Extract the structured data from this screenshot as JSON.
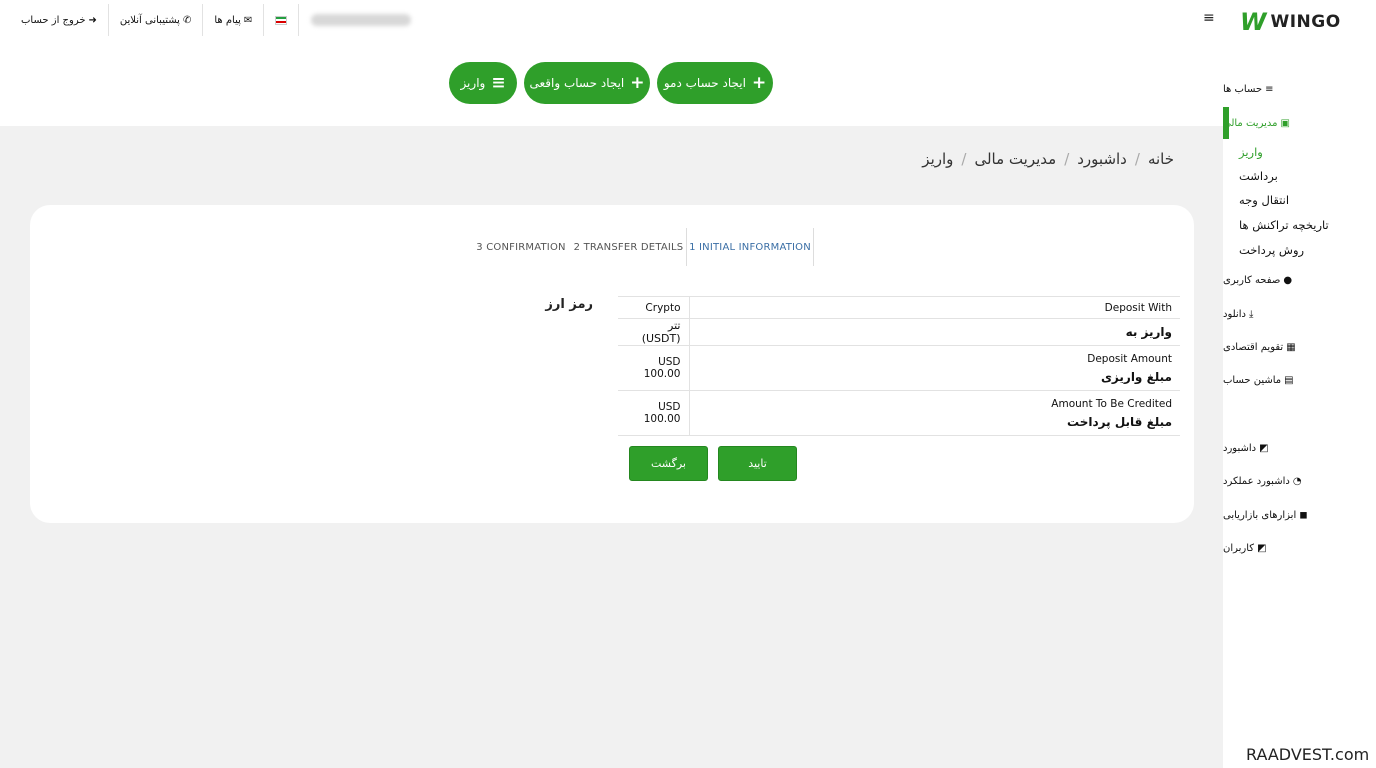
{
  "topbar": {
    "logout": "خروج از حساب",
    "support": "پشتیبانی آنلاین",
    "messages": "پیام ها",
    "flag_colors": [
      "#239f40",
      "#ffffff",
      "#da0000"
    ],
    "menu_icon": "hamburger-icon"
  },
  "actions": {
    "demo": "ایجاد حساب دمو",
    "real": "ایجاد حساب واقعی",
    "deposit": "واریز",
    "accent": "#2f9f2a"
  },
  "breadcrumb": [
    "خانه",
    "داشبورد",
    "مدیریت مالی",
    "واریز"
  ],
  "steps": [
    {
      "label": "3 CONFIRMATION"
    },
    {
      "label": "2 TRANSFER DETAILS"
    },
    {
      "label": "1 INITIAL INFORMATION"
    }
  ],
  "section_label": "رمز ارز",
  "rows": [
    {
      "key": "Deposit With",
      "value": "Crypto"
    },
    {
      "key": "واریز به",
      "value": "تتر (USDT)"
    },
    {
      "key": "Deposit Amount",
      "key_fa": "مبلغ واریزی",
      "value": "USD 100.00"
    },
    {
      "key": "Amount To Be Credited",
      "key_fa": "مبلغ قابل پرداخت",
      "value": "USD 100.00"
    }
  ],
  "buttons": {
    "back": "برگشت",
    "confirm": "تایید"
  },
  "sidebar": {
    "logo_mark": "W",
    "logo_text": "WINGO",
    "accounts": "حساب ها",
    "finance": "مدیریت مالی",
    "finance_sub": [
      "واریز",
      "برداشت",
      "انتقال وجه",
      "تاریخچه تراکنش ها",
      "روش پرداخت"
    ],
    "profile": "صفحه کاربری",
    "download": "دانلود",
    "calendar": "تقویم اقتصادی",
    "calculator": "ماشین حساب",
    "dashboard": "داشبورد",
    "performance": "داشبورد عملکرد",
    "tools": "ابزارهای بازاریابی",
    "partners": "کاربران"
  },
  "watermark": "RAADVEST.com"
}
